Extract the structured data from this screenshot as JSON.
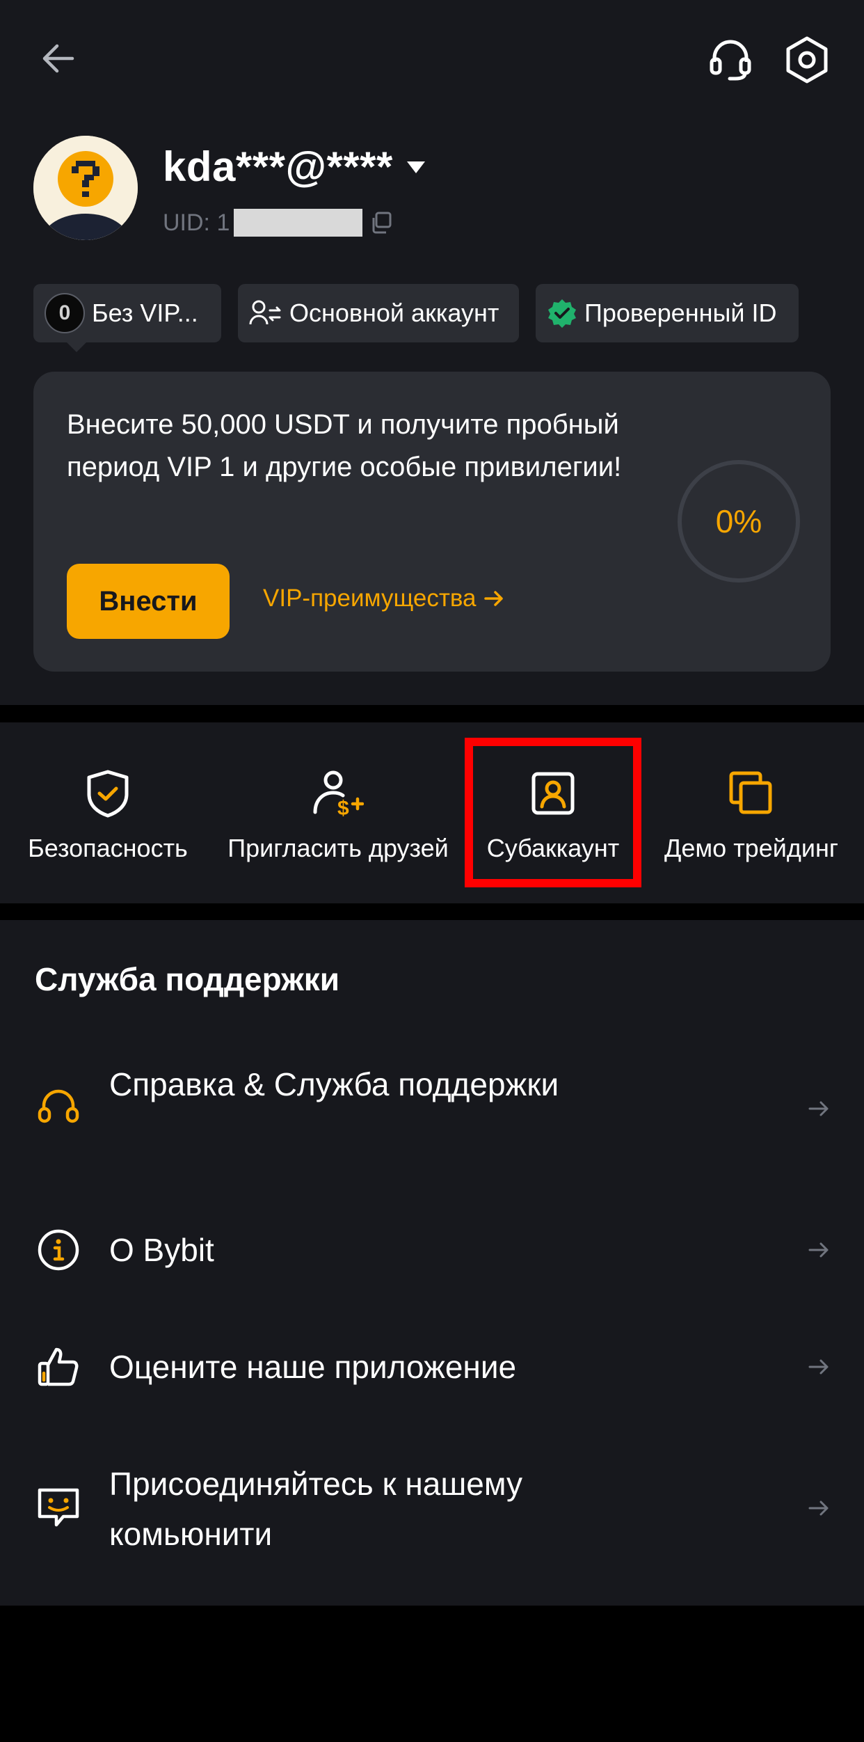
{
  "header": {
    "back_icon": "arrow-left-icon",
    "support_icon": "headset-icon",
    "settings_icon": "hexagon-gear-icon"
  },
  "profile": {
    "username": "kda***@****",
    "uid_label": "UID: 1",
    "avatar_icon": "question-mark-avatar"
  },
  "badges": {
    "vip_level": "0",
    "vip_label": "Без VIP...",
    "account_label": "Основной аккаунт",
    "verified_label": "Проверенный ID"
  },
  "promo": {
    "text": "Внесите 50,000 USDT и получите пробный период VIP 1 и другие особые привилегии!",
    "deposit_label": "Внести",
    "vip_link_label": "VIP-преимущества",
    "progress_label": "0%",
    "progress_value": 0
  },
  "shortcuts": [
    {
      "label": "Безопасность",
      "icon": "shield-check-icon"
    },
    {
      "label": "Пригласить друзей",
      "icon": "user-dollar-icon"
    },
    {
      "label": "Субаккаунт",
      "icon": "user-square-icon"
    },
    {
      "label": "Демо трейдинг",
      "icon": "stacked-squares-icon"
    }
  ],
  "support": {
    "title": "Служба поддержки",
    "items": [
      {
        "label": "Справка & Служба поддержки",
        "icon": "headset-icon"
      },
      {
        "label": "О Bybit",
        "icon": "info-icon"
      },
      {
        "label": "Оцените наше приложение",
        "icon": "thumbs-up-icon"
      },
      {
        "label": "Присоединяйтесь к нашему комьюнити",
        "icon": "chat-smile-icon"
      }
    ]
  },
  "colors": {
    "background": "#17181d",
    "card": "#2b2d33",
    "accent": "#f7a600",
    "verified": "#20b26c",
    "highlight": "#ff0000"
  }
}
